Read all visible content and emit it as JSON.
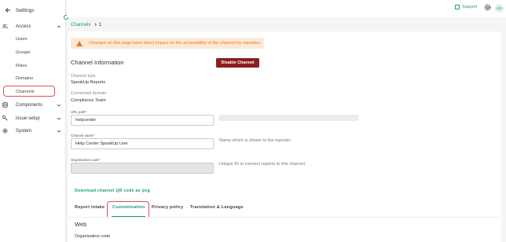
{
  "sidebar": {
    "title": "Settings",
    "items": [
      {
        "label": "Access",
        "icon": "users-icon",
        "expanded": true
      },
      {
        "label": "Components",
        "icon": "database-icon",
        "expanded": false
      },
      {
        "label": "Issue setup",
        "icon": "key-icon",
        "expanded": false
      },
      {
        "label": "System",
        "icon": "gear-icon",
        "expanded": false
      }
    ],
    "subitems": [
      "Users",
      "Groups",
      "Roles",
      "Domains",
      "Channels"
    ]
  },
  "topbar": {
    "support_label": "Support",
    "avatar_initials": "KD"
  },
  "breadcrumb": {
    "parent": "Channels",
    "current": "1"
  },
  "warning": {
    "text": "Changes on this page have direct impact on the accessibility of the channel by reporters."
  },
  "channel_info": {
    "title": "Channel Information",
    "disable_button": "Disable Channel",
    "channel_type_label": "Channel type",
    "channel_type_value": "SpeakUp Reports",
    "connected_domain_label": "Connected domain",
    "connected_domain_value": "Compliance Team",
    "url_path_label": "URL path*",
    "url_path_value": "helpcenter",
    "channel_name_label": "Channel name*",
    "channel_name_value": "Help Center SpeakUp Line",
    "channel_name_hint": "Name which is shown to the reporter.",
    "org_code_label": "Organisation code*",
    "org_code_value": "",
    "org_code_hint": "Unique ID to connect reports to this channel.",
    "download_link": "Download channel QR code as png"
  },
  "tabs": [
    {
      "label": "Report intake",
      "active": false
    },
    {
      "label": "Customisation",
      "active": true
    },
    {
      "label": "Privacy policy",
      "active": false
    },
    {
      "label": "Translation & Language",
      "active": false
    }
  ],
  "section": {
    "title": "Web",
    "subtitle": "Organisation code"
  },
  "colors": {
    "accent": "#1a9b78",
    "danger": "#8b1e1e",
    "warning_bg": "#fde9d6",
    "warning_text": "#e07b2a",
    "highlight": "#d9534f"
  }
}
